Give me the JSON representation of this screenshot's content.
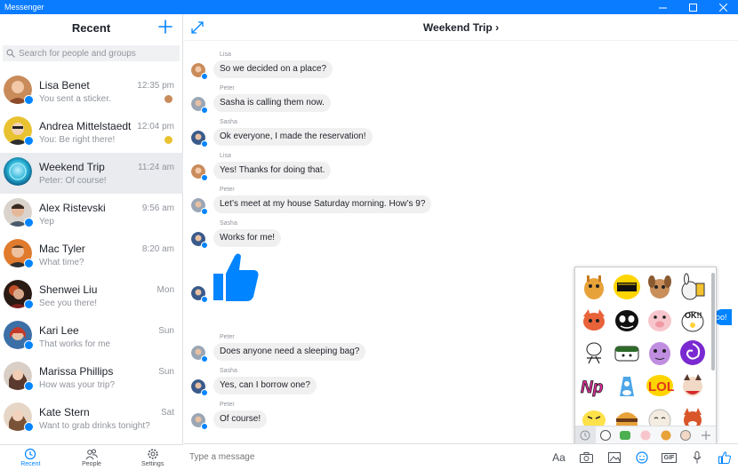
{
  "app": {
    "title": "Messenger"
  },
  "sidebar": {
    "title": "Recent",
    "search_placeholder": "Search for people and groups",
    "conversations": [
      {
        "name": "Lisa Benet",
        "preview": "You sent a sticker.",
        "time": "12:35 pm",
        "avatar_color": "#c98b5a"
      },
      {
        "name": "Andrea Mittelstaedt",
        "preview": "You: Be right there!",
        "time": "12:04 pm",
        "avatar_color": "#e8c230"
      },
      {
        "name": "Weekend Trip",
        "preview": "Peter: Of course!",
        "time": "11:24 am",
        "avatar_color": "#2a9fb8"
      },
      {
        "name": "Alex Ristevski",
        "preview": "Yep",
        "time": "9:56 am",
        "avatar_color": "#7d6a5a"
      },
      {
        "name": "Mac Tyler",
        "preview": "What time?",
        "time": "8:20 am",
        "avatar_color": "#e07b2e"
      },
      {
        "name": "Shenwei Liu",
        "preview": "See you there!",
        "time": "Mon",
        "avatar_color": "#b5332a"
      },
      {
        "name": "Kari Lee",
        "preview": "That works for me",
        "time": "Sun",
        "avatar_color": "#3b6fa6"
      },
      {
        "name": "Marissa Phillips",
        "preview": "How was your trip?",
        "time": "Sun",
        "avatar_color": "#8a5a48"
      },
      {
        "name": "Kate Stern",
        "preview": "Want to grab drinks tonight?",
        "time": "Sat",
        "avatar_color": "#b88060"
      }
    ]
  },
  "nav": {
    "recent": "Recent",
    "people": "People",
    "settings": "Settings"
  },
  "chat": {
    "title": "Weekend Trip",
    "messages": [
      {
        "sender": "Lisa",
        "text": "So we decided on a place?"
      },
      {
        "sender": "Peter",
        "text": "Sasha is calling them now."
      },
      {
        "sender": "Sasha",
        "text": "Ok everyone, I made the reservation!"
      },
      {
        "sender": "Lisa",
        "text": "Yes! Thanks for doing that."
      },
      {
        "sender": "Peter",
        "text": "Let’s meet at my house Saturday morning. How’s 9?"
      },
      {
        "sender": "Sasha",
        "text": "Works for me!"
      },
      {
        "sender": "Peter",
        "text": "Does anyone need a sleeping bag?"
      },
      {
        "sender": "Sasha",
        "text": "Yes, can I borrow one?"
      },
      {
        "sender": "Peter",
        "text": "Of course!"
      }
    ],
    "partial_sent_text": "oo!"
  },
  "composer": {
    "placeholder": "Type a message",
    "text_tool": "Aa",
    "gif_tool": "GIF"
  },
  "colors": {
    "accent": "#0084ff",
    "titlebar": "#0a7cff",
    "bubble": "#f1f0f0"
  }
}
